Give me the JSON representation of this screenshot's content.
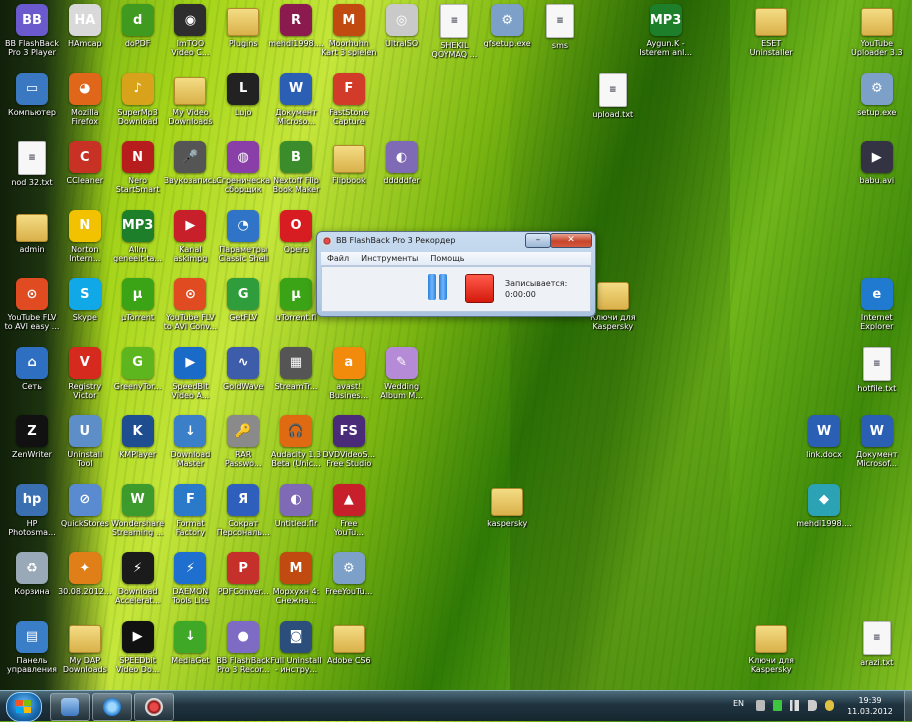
{
  "icons": [
    {
      "label": "BB FlashBack\nPro 3 Player",
      "icon": "flashback-player-icon",
      "color": "#6a5acd",
      "glyph": "BB"
    },
    {
      "label": "HAmcap",
      "icon": "webcam-icon",
      "color": "#d9d9d9",
      "glyph": "HA"
    },
    {
      "label": "doPDF",
      "icon": "pdf-printer-icon",
      "color": "#3f9a1f",
      "glyph": "d"
    },
    {
      "label": "ImTOO\nVideo C...",
      "icon": "video-converter-icon",
      "color": "#2d2d2d",
      "glyph": "◉"
    },
    {
      "label": "Plugins",
      "icon": "folder-icon",
      "color": "folder",
      "glyph": ""
    },
    {
      "label": "mehdi1998....",
      "icon": "winrar-archive-icon",
      "color": "#8b1a4e",
      "glyph": "R"
    },
    {
      "label": "Moorhuhn\nKart 3 spielen",
      "icon": "moorhuhn-game-icon",
      "color": "#c04a10",
      "glyph": "M"
    },
    {
      "label": "UltraISO",
      "icon": "disc-icon",
      "color": "#c9c9c9",
      "glyph": "◎"
    },
    {
      "label": "SHEKIL\nQOYMAQ ...",
      "icon": "document-icon",
      "color": "doc",
      "glyph": "≡"
    },
    {
      "label": "gfsetup.exe",
      "icon": "installer-icon",
      "color": "#7ca0c8",
      "glyph": "⚙"
    },
    {
      "label": "sms",
      "icon": "document-icon",
      "color": "doc",
      "glyph": "≡"
    },
    {
      "label": "Aygun.K -\nIsterem anl...",
      "icon": "mp3-file-icon",
      "color": "#1d7f2a",
      "glyph": "MP3"
    },
    {
      "label": "ESET\nUninstaller",
      "icon": "folder-icon",
      "color": "folder",
      "glyph": ""
    },
    {
      "label": "YouTube\nUploader 3.3",
      "icon": "folder-icon",
      "color": "folder",
      "glyph": ""
    },
    {
      "label": "Компьютер",
      "icon": "computer-icon",
      "color": "#3a78c2",
      "glyph": "▭"
    },
    {
      "label": "Mozilla\nFirefox",
      "icon": "firefox-icon",
      "color": "#e0661a",
      "glyph": "◕"
    },
    {
      "label": "SuperMp3\nDownload",
      "icon": "music-download-icon",
      "color": "#d8a21a",
      "glyph": "♪"
    },
    {
      "label": "My Video\nDownloads",
      "icon": "folder-icon",
      "color": "folder",
      "glyph": ""
    },
    {
      "label": "Lujo",
      "icon": "lujo-icon",
      "color": "#222",
      "glyph": "L"
    },
    {
      "label": "Документ\nMicroso...",
      "icon": "word-document-icon",
      "color": "#2b5fb4",
      "glyph": "W"
    },
    {
      "label": "FastStone\nCapture",
      "icon": "faststone-capture-icon",
      "color": "#d23b2a",
      "glyph": "F"
    },
    {
      "label": "upload.txt",
      "icon": "text-file-icon",
      "color": "doc",
      "glyph": "≡"
    },
    {
      "label": "setup.exe",
      "icon": "installer-icon",
      "color": "#7ca0c8",
      "glyph": "⚙"
    },
    {
      "label": "nod 32.txt",
      "icon": "text-file-icon",
      "color": "doc",
      "glyph": "≡"
    },
    {
      "label": "CCleaner",
      "icon": "ccleaner-icon",
      "color": "#c83224",
      "glyph": "C"
    },
    {
      "label": "Nero\nStartSmart",
      "icon": "nero-icon",
      "color": "#b81d1d",
      "glyph": "N"
    },
    {
      "label": "Звукозапись",
      "icon": "microphone-icon",
      "color": "#555",
      "glyph": "🎤"
    },
    {
      "label": "Сгреническа\nсборщик",
      "icon": "orb-icon",
      "color": "#8a3fa8",
      "glyph": "◍"
    },
    {
      "label": "Nextoff Flip\nBook Maker",
      "icon": "book-icon",
      "color": "#3a8d2a",
      "glyph": "B"
    },
    {
      "label": "Flipbook",
      "icon": "folder-icon",
      "color": "folder",
      "glyph": ""
    },
    {
      "label": "dddddfer",
      "icon": "disc-tool-icon",
      "color": "#7f6ab6",
      "glyph": "◐"
    },
    {
      "label": "babu.avi",
      "icon": "video-file-icon",
      "color": "#334",
      "glyph": "▶"
    },
    {
      "label": "admin",
      "icon": "user-folder-icon",
      "color": "folder",
      "glyph": ""
    },
    {
      "label": "Norton\nIntern...",
      "icon": "norton-icon",
      "color": "#f2c200",
      "glyph": "N"
    },
    {
      "label": "Allm\ngeneelt-ta...",
      "icon": "mp3-file-icon",
      "color": "#1d7f2a",
      "glyph": "MP3"
    },
    {
      "label": "Kanal\naskimpg",
      "icon": "video-file-icon",
      "color": "#c7202a",
      "glyph": "▶"
    },
    {
      "label": "Параметры\nClassic Shell",
      "icon": "shell-settings-icon",
      "color": "#2f74c6",
      "glyph": "◔"
    },
    {
      "label": "Opera",
      "icon": "opera-icon",
      "color": "#d81d22",
      "glyph": "O"
    },
    {
      "label": "YouTube FLV\nto AVI easy ...",
      "icon": "youtube-converter-icon",
      "color": "#e14b21",
      "glyph": "⊙"
    },
    {
      "label": "Skype",
      "icon": "skype-icon",
      "color": "#10a8e6",
      "glyph": "S"
    },
    {
      "label": "µTorrent",
      "icon": "utorrent-icon",
      "color": "#3ba316",
      "glyph": "µ"
    },
    {
      "label": "YouTube FLV\nto AVI Conv...",
      "icon": "youtube-converter-icon",
      "color": "#e14b21",
      "glyph": "⊙"
    },
    {
      "label": "GetFLV",
      "icon": "getflv-icon",
      "color": "#2f9d3b",
      "glyph": "G"
    },
    {
      "label": "uTorrent.fl",
      "icon": "utorrent-icon",
      "color": "#3ba316",
      "glyph": "µ"
    },
    {
      "label": "Ключи для\nKaspersky",
      "icon": "folder-icon",
      "color": "folder",
      "glyph": ""
    },
    {
      "label": "Internet\nExplorer",
      "icon": "internet-explorer-icon",
      "color": "#1f7ad0",
      "glyph": "e"
    },
    {
      "label": "Сеть",
      "icon": "network-icon",
      "color": "#2f6fc1",
      "glyph": "⌂"
    },
    {
      "label": "Registry\nVictor",
      "icon": "registry-icon",
      "color": "#d62a1e",
      "glyph": "V"
    },
    {
      "label": "GreenyTor...",
      "icon": "torrent-client-icon",
      "color": "#5db61e",
      "glyph": "G"
    },
    {
      "label": "SpeedBit\nVideo A...",
      "icon": "speedbit-icon",
      "color": "#1a6ac8",
      "glyph": "▶"
    },
    {
      "label": "GoldWave",
      "icon": "goldwave-icon",
      "color": "#3d5caa",
      "glyph": "∿"
    },
    {
      "label": "StreamTr...",
      "icon": "film-icon",
      "color": "#555",
      "glyph": "▦"
    },
    {
      "label": "avast!\nBusines...",
      "icon": "avast-icon",
      "color": "#f28a0c",
      "glyph": "a"
    },
    {
      "label": "Wedding\nAlbum M...",
      "icon": "wedding-album-icon",
      "color": "#b58ad6",
      "glyph": "✎"
    },
    {
      "label": "hotfile.txt",
      "icon": "text-file-icon",
      "color": "doc",
      "glyph": "≡"
    },
    {
      "label": "ZenWriter",
      "icon": "zenwriter-icon",
      "color": "#111",
      "glyph": "Z"
    },
    {
      "label": "Uninstall\nTool",
      "icon": "uninstall-tool-icon",
      "color": "#5d8ec8",
      "glyph": "U"
    },
    {
      "label": "KMPlayer",
      "icon": "kmplayer-icon",
      "color": "#1e4e8f",
      "glyph": "K"
    },
    {
      "label": "Download\nMaster",
      "icon": "download-master-icon",
      "color": "#3a7fc7",
      "glyph": "↓"
    },
    {
      "label": "RAR\nPasswo...",
      "icon": "rar-password-icon",
      "color": "#8a8a8a",
      "glyph": "🔑"
    },
    {
      "label": "Audacity 1.3\nBeta (Unic...",
      "icon": "audacity-icon",
      "color": "#e06a12",
      "glyph": "🎧"
    },
    {
      "label": "DVDVideoS...\nFree Studio",
      "icon": "free-studio-icon",
      "color": "#4a2b7a",
      "glyph": "FS"
    },
    {
      "label": "link.docx",
      "icon": "word-document-icon",
      "color": "#2b5fb4",
      "glyph": "W"
    },
    {
      "label": "Документ\nMicrosof...",
      "icon": "word-document-icon",
      "color": "#2b5fb4",
      "glyph": "W"
    },
    {
      "label": "HP\nPhotosma...",
      "icon": "hp-photosmart-icon",
      "color": "#3a6fb2",
      "glyph": "hp"
    },
    {
      "label": "QuickStores",
      "icon": "quickstores-icon",
      "color": "#5a8bd1",
      "glyph": "⊘"
    },
    {
      "label": "Wondershare\nStreaming ...",
      "icon": "wondershare-icon",
      "color": "#3d9b2d",
      "glyph": "W"
    },
    {
      "label": "Format\nFactory",
      "icon": "format-factory-icon",
      "color": "#2a7ac9",
      "glyph": "F"
    },
    {
      "label": "Сократ\nПерсональ...",
      "icon": "socrat-icon",
      "color": "#2e5fbc",
      "glyph": "Я"
    },
    {
      "label": "Untitled.flr",
      "icon": "disc-tool-icon",
      "color": "#7f6ab6",
      "glyph": "◐"
    },
    {
      "label": "Free\nYouTu...",
      "icon": "free-youtube-icon",
      "color": "#c7202a",
      "glyph": "▲"
    },
    {
      "label": "kaspersky",
      "icon": "folder-icon",
      "color": "folder",
      "glyph": ""
    },
    {
      "label": "mehdi1998....",
      "icon": "puzzle-icon",
      "color": "#2ba3b5",
      "glyph": "◆"
    },
    {
      "label": "Корзина",
      "icon": "recycle-bin-icon",
      "color": "#9aa9b8",
      "glyph": "♻"
    },
    {
      "label": "30.08.2012...",
      "icon": "image-file-icon",
      "color": "#e07e18",
      "glyph": "✦"
    },
    {
      "label": "Download\nAccelerat...",
      "icon": "download-accelerator-icon",
      "color": "#1b1b1b",
      "glyph": "⚡"
    },
    {
      "label": "DAEMON\nTools Lite",
      "icon": "daemon-tools-icon",
      "color": "#1f6fd0",
      "glyph": "⚡"
    },
    {
      "label": "PDFConver...",
      "icon": "pdf-converter-icon",
      "color": "#c6302a",
      "glyph": "P"
    },
    {
      "label": "Морхухн 4:\nСнежна...",
      "icon": "moorhuhn-game-icon",
      "color": "#c04a10",
      "glyph": "M"
    },
    {
      "label": "FreeYouTu...",
      "icon": "installer-icon",
      "color": "#7ca0c8",
      "glyph": "⚙"
    },
    {
      "label": "Панель\nуправления",
      "icon": "control-panel-icon",
      "color": "#3a7ec8",
      "glyph": "▤"
    },
    {
      "label": "My DAP\nDownloads",
      "icon": "folder-icon",
      "color": "folder",
      "glyph": ""
    },
    {
      "label": "SPEEDbit\nVideo Do...",
      "icon": "speedbit-icon",
      "color": "#111",
      "glyph": "▶"
    },
    {
      "label": "MediaGet",
      "icon": "mediaget-icon",
      "color": "#3fa826",
      "glyph": "↓"
    },
    {
      "label": "BB FlashBack\nPro 3 Recor...",
      "icon": "flashback-recorder-icon",
      "color": "#7e6bc4",
      "glyph": "●"
    },
    {
      "label": "Full Uninstall\n- инстру...",
      "icon": "full-uninstall-icon",
      "color": "#2b4e7a",
      "glyph": "◙"
    },
    {
      "label": "Adobe CS6",
      "icon": "folder-icon",
      "color": "folder",
      "glyph": ""
    },
    {
      "label": "Ключи для\nKaspersky",
      "icon": "folder-icon",
      "color": "folder",
      "glyph": ""
    },
    {
      "label": "arazi.txt",
      "icon": "text-file-icon",
      "color": "doc",
      "glyph": "≡"
    }
  ],
  "recorder": {
    "title": "BB FlashBack Pro 3 Рекордер",
    "close_glyph": "✕",
    "minimize_glyph": "–",
    "menu": [
      "Файл",
      "Инструменты",
      "Помощь"
    ],
    "status_label": "Записывается:",
    "timer": "0:00:00"
  },
  "taskbar": {
    "language": "EN",
    "time": "19:39",
    "date": "11.03.2012"
  }
}
